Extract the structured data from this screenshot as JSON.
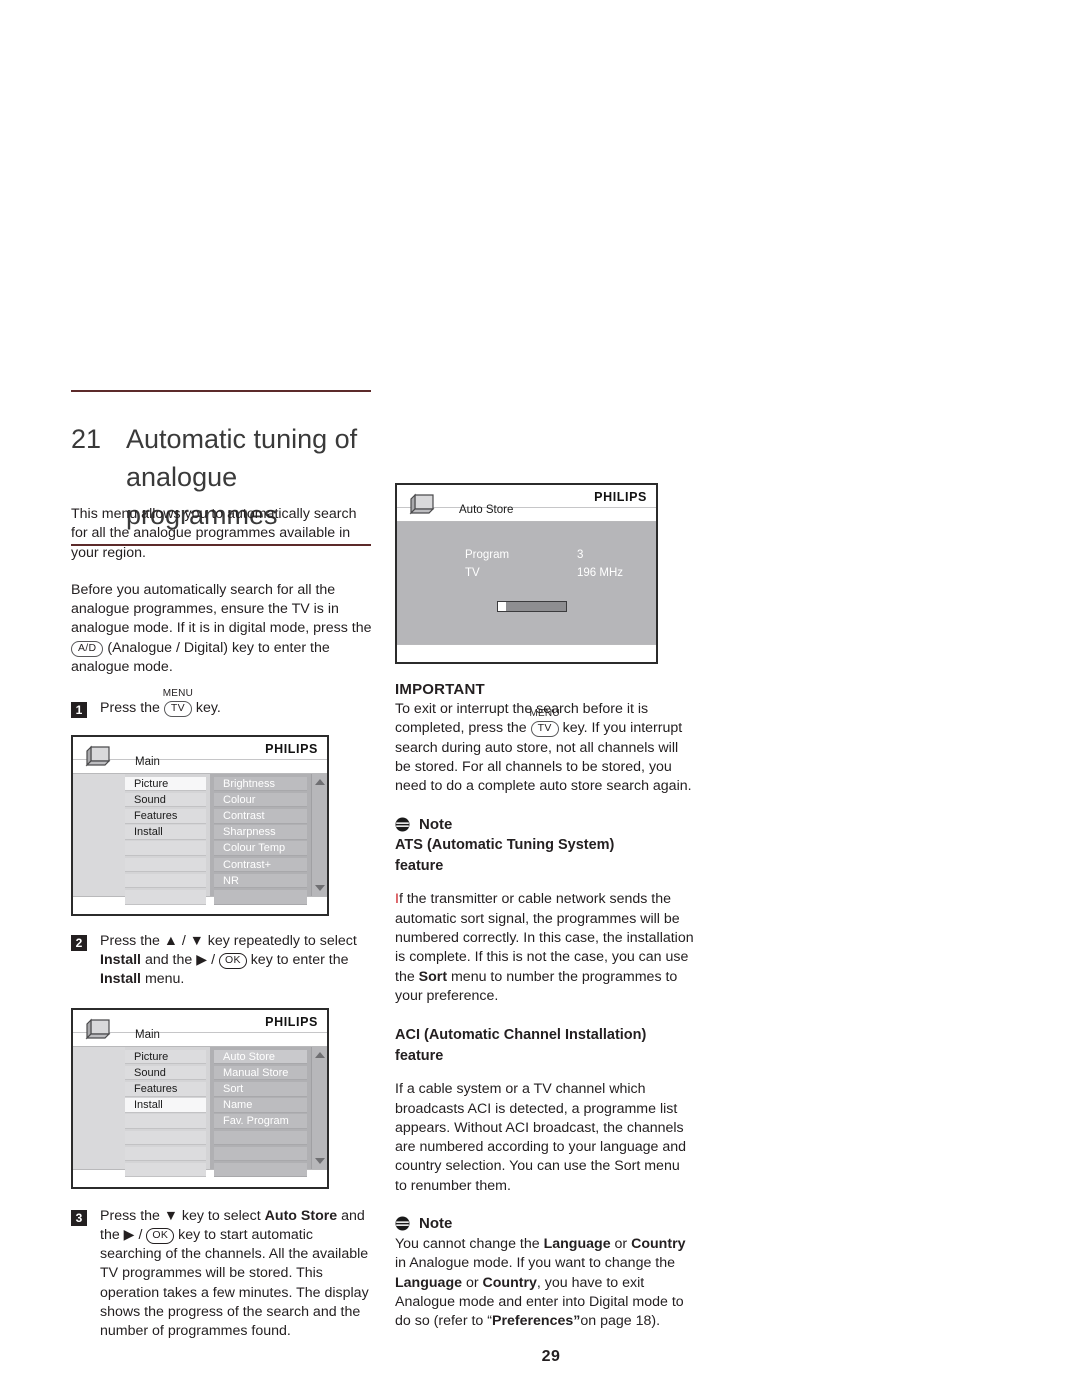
{
  "page": {
    "number": "29"
  },
  "header": {
    "chapter_number": "21",
    "title_line1": "Automatic tuning of",
    "title_line2": "analogue programmes",
    "rule_color": "#5c2a2a"
  },
  "left_column": {
    "intro": "This menu allows you to automatically search for all the analogue programmes available in your region.",
    "before_part1": "Before you automatically search for all the analogue programmes, ensure the TV is in analogue mode. If it is in digital mode, press the ",
    "before_key": "A/D",
    "before_part2": " (Analogue / Digital) key to enter the analogue mode.",
    "steps": [
      {
        "number": "1",
        "text_part1": "Press the ",
        "key_cap": "MENU",
        "key_label": "TV",
        "text_part2": " key."
      },
      {
        "number": "2",
        "text_part1": "Press the ",
        "arrow_up": "▲",
        "sep": " / ",
        "arrow_down": "▼",
        "text_part2": " key repeatedly to select ",
        "bold1": "Install",
        "text_part3": " and the ",
        "arrow_right": "▶",
        "key_label": "OK",
        "text_part4": " key to enter the ",
        "bold2": "Install",
        "text_part5": " menu."
      },
      {
        "number": "3",
        "text_part1": "Press the ",
        "arrow_down": "▼",
        "text_part2": " key to select ",
        "bold1": "Auto Store",
        "text_part3": " and the ",
        "arrow_right": "▶",
        "key_label": "OK",
        "text_part4": " key to start automatic searching of the channels. All the available TV programmes will be stored. This operation takes a few minutes. The display shows the progress of the search and the number of programmes found."
      }
    ]
  },
  "osd_main_menu": {
    "brand": "PHILIPS",
    "title": "Main",
    "left_items": [
      {
        "label": "Picture",
        "selected": true
      },
      {
        "label": "Sound",
        "selected": false
      },
      {
        "label": "Features",
        "selected": false
      },
      {
        "label": "Install",
        "selected": false
      },
      {
        "label": "",
        "selected": false
      },
      {
        "label": "",
        "selected": false
      },
      {
        "label": "",
        "selected": false
      },
      {
        "label": "",
        "selected": false
      }
    ],
    "right_items": [
      {
        "label": "Brightness"
      },
      {
        "label": "Colour"
      },
      {
        "label": "Contrast"
      },
      {
        "label": "Sharpness"
      },
      {
        "label": "Colour Temp"
      },
      {
        "label": "Contrast+"
      },
      {
        "label": "NR"
      },
      {
        "label": ""
      }
    ]
  },
  "osd_install_menu": {
    "brand": "PHILIPS",
    "title": "Main",
    "left_items": [
      {
        "label": "Picture",
        "selected": false
      },
      {
        "label": "Sound",
        "selected": false
      },
      {
        "label": "Features",
        "selected": false
      },
      {
        "label": "Install",
        "selected": true
      },
      {
        "label": "",
        "selected": false
      },
      {
        "label": "",
        "selected": false
      },
      {
        "label": "",
        "selected": false
      },
      {
        "label": "",
        "selected": false
      }
    ],
    "right_items": [
      {
        "label": "Auto Store"
      },
      {
        "label": "Manual Store"
      },
      {
        "label": "Sort"
      },
      {
        "label": "Name"
      },
      {
        "label": "Fav. Program"
      },
      {
        "label": ""
      },
      {
        "label": ""
      },
      {
        "label": ""
      }
    ]
  },
  "osd_auto_store": {
    "brand": "PHILIPS",
    "title": "Auto Store",
    "label_program": "Program",
    "value_program": "3",
    "label_tv": "TV",
    "value_frequency": "196 MHz",
    "progress_percent": 12
  },
  "right_column": {
    "important": {
      "heading": "IMPORTANT",
      "text_part1": "To exit or interrupt the search before it is completed, press the ",
      "key_cap": "MENU",
      "key_label": "TV",
      "text_part2": " key. If you interrupt search during auto store, not all channels will be stored. For all channels to be stored, you need to do a complete auto store search again."
    },
    "note_ats": {
      "note_label": "Note",
      "subheading_line1": "ATS (Automatic Tuning System)",
      "subheading_line2": "feature",
      "body_lead": "I",
      "body_part1": "f the transmitter or cable network sends the automatic sort signal, the programmes will be numbered correctly. In this case, the installation is complete. If this is not the case, you can use the ",
      "bold1": "Sort",
      "body_part2": " menu to number the programmes to your preference."
    },
    "aci": {
      "subheading_line1": "ACI (Automatic Channel Installation)",
      "subheading_line2": "feature",
      "body": "If a cable system or a TV channel which broadcasts ACI is detected, a programme list appears. Without ACI broadcast, the channels are numbered according to your language and country selection. You can use the Sort menu to renumber them."
    },
    "note_language": {
      "note_label": "Note",
      "text_part1": "You cannot change the ",
      "bold1": "Language",
      "text_part2": " or ",
      "bold2": "Country",
      "text_part3": " in Analogue mode. If you want to change the ",
      "bold3": "Language",
      "text_part4": " or ",
      "bold4": "Country",
      "text_part5": ", you have to exit Analogue mode and enter into Digital mode to do so (refer to “",
      "bold5": "Preferences”",
      "text_part6": "on page 18)."
    }
  }
}
